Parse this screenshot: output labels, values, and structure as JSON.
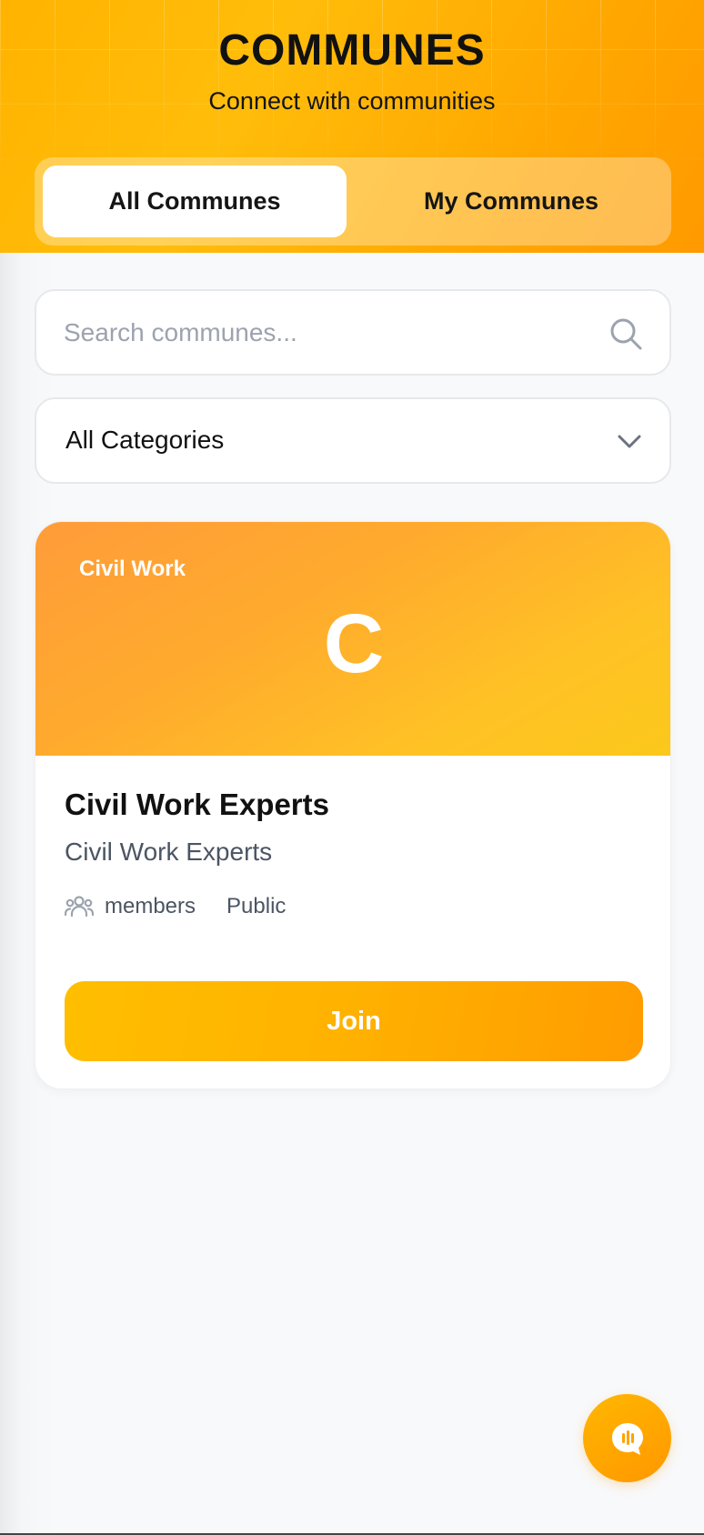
{
  "header": {
    "title": "COMMUNES",
    "subtitle": "Connect with communities",
    "tabs": [
      {
        "label": "All Communes",
        "active": true
      },
      {
        "label": "My Communes",
        "active": false
      }
    ]
  },
  "search": {
    "placeholder": "Search communes...",
    "value": "",
    "icon": "search-icon"
  },
  "category_filter": {
    "selected": "All Categories",
    "icon": "chevron-down-icon"
  },
  "communes": [
    {
      "category": "Civil Work",
      "initial": "C",
      "name": "Civil Work Experts",
      "description": "Civil Work Experts",
      "members_label": "members",
      "visibility": "Public",
      "action_label": "Join"
    }
  ],
  "fab": {
    "icon": "voice-chat-icon"
  },
  "colors": {
    "accent": "#ffb300",
    "accent_dark": "#ff9c00",
    "banner_start": "#ff9c3a",
    "banner_end": "#fcc81b",
    "text_primary": "#111111",
    "text_secondary": "#4b5563"
  }
}
